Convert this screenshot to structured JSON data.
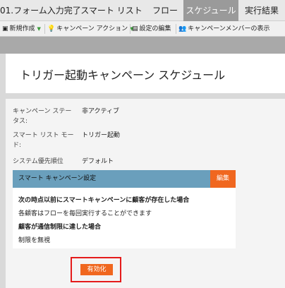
{
  "tabs": [
    {
      "label": "01.フォーム入力完了"
    },
    {
      "label": "スマート リスト"
    },
    {
      "label": "フロー"
    },
    {
      "label": "スケジュール"
    },
    {
      "label": "実行結果"
    }
  ],
  "toolbar": {
    "new_label": "新規作成",
    "campaign_action_label": "キャンペーン アクション",
    "edit_settings_label": "設定の編集",
    "view_members_label": "キャンペーンメンバーの表示"
  },
  "page_title": "トリガー起動キャンペーン スケジュール",
  "info": {
    "status_label": "キャンペーン ステータス:",
    "status_value": "非アクティブ",
    "mode_label": "スマート リスト モード:",
    "mode_value": "トリガー起動",
    "priority_label": "システム優先順位",
    "priority_value": "デフォルト"
  },
  "smart_campaign_settings": {
    "title": "スマート キャンペーン設定",
    "edit_label": "編集",
    "line1": "次の時点以前にスマートキャンペーンに顧客が存在した場合",
    "line2": "各顧客はフローを毎回実行することができます",
    "line3": "顧客が通信制限に達した場合",
    "line4": "制限を無視"
  },
  "activate_label": "有効化"
}
